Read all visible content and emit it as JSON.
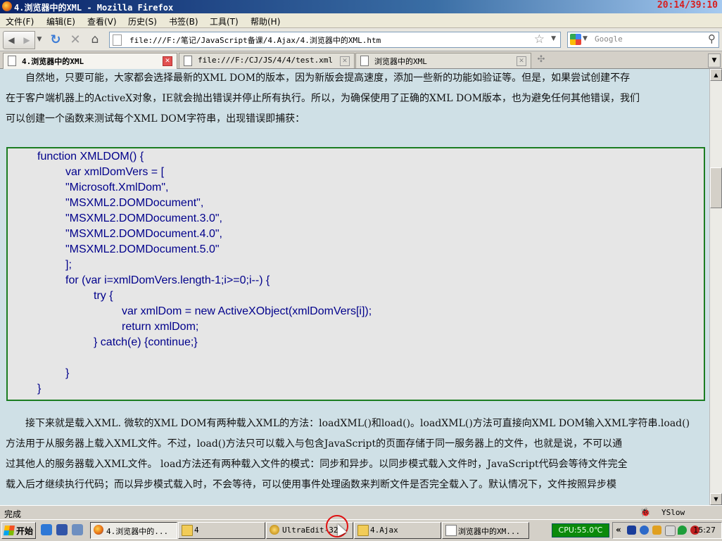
{
  "window": {
    "title": "4.浏览器中的XML - Mozilla Firefox",
    "overlay_clock": "20:14/39:10"
  },
  "menu": [
    "文件(F)",
    "编辑(E)",
    "查看(V)",
    "历史(S)",
    "书签(B)",
    "工具(T)",
    "帮助(H)"
  ],
  "nav": {
    "url": "file:///F:/笔记/JavaScript备课/4.Ajax/4.浏览器中的XML.htm",
    "search_placeholder": "Google"
  },
  "tabs": [
    {
      "label": "4.浏览器中的XML",
      "active": true
    },
    {
      "label": "file:///F:/CJ/JS/4/4/test.xml",
      "active": false
    },
    {
      "label": "浏览器中的XML",
      "active": false
    }
  ],
  "content": {
    "para1": [
      "　　自然地，只要可能，大家都会选择最新的XML DOM的版本，因为新版会提高速度，添加一些新的功能如验证等。但是，如果尝试创建不存",
      "在于客户端机器上的ActiveX对象，IE就会抛出错误并停止所有执行。所以，为确保使用了正确的XML DOM版本，也为避免任何其他错误，我们",
      "可以创建一个函数来测试每个XML DOM字符串，出现错误即捕获："
    ],
    "code": [
      {
        "indent": 0,
        "text": "function XMLDOM() {"
      },
      {
        "indent": 1,
        "text": "var xmlDomVers = ["
      },
      {
        "indent": 1,
        "text": "\"Microsoft.XmlDom\","
      },
      {
        "indent": 1,
        "text": "\"MSXML2.DOMDocument\","
      },
      {
        "indent": 1,
        "text": "\"MSXML2.DOMDocument.3.0\","
      },
      {
        "indent": 1,
        "text": "\"MSXML2.DOMDocument.4.0\","
      },
      {
        "indent": 1,
        "text": "\"MSXML2.DOMDocument.5.0\""
      },
      {
        "indent": 1,
        "text": "];"
      },
      {
        "indent": 1,
        "text": "for (var i=xmlDomVers.length-1;i>=0;i--) {"
      },
      {
        "indent": 2,
        "text": "try {"
      },
      {
        "indent": 3,
        "text": "var xmlDom = new ActiveXObject(xmlDomVers[i]);"
      },
      {
        "indent": 3,
        "text": "return xmlDom;"
      },
      {
        "indent": 2,
        "text": "} catch(e) {continue;}"
      },
      {
        "indent": 0,
        "text": ""
      },
      {
        "indent": 2,
        "text": "}"
      },
      {
        "indent": 0,
        "text": "}"
      }
    ],
    "para2": [
      "　　接下来就是载入XML. 微软的XML DOM有两种载入XML的方法：loadXML()和load()。loadXML()方法可直接向XML DOM输入XML字符串.load()",
      "方法用于从服务器上载入XML文件。不过，load()方法只可以载入与包含JavaScript的页面存储于同一服务器上的文件，也就是说，不可以通",
      "过其他人的服务器载入XML文件。 load方法还有两种载入文件的模式：同步和异步。以同步模式载入文件时，JavaScript代码会等待文件完全",
      "载入后才继续执行代码；而以异步模式载入时，不会等待，可以使用事件处理函数来判断文件是否完全载入了。默认情况下，文件按照异步模"
    ]
  },
  "status": {
    "text": "完成",
    "yslow": "YSlow"
  },
  "taskbar": {
    "start": "开始",
    "buttons": [
      {
        "label": "4.浏览器中的...",
        "icon": "firefox-icon"
      },
      {
        "label": "4",
        "icon": "folder-icon"
      },
      {
        "label": "UltraEdit-32",
        "icon": "ultraedit-icon"
      },
      {
        "label": "4.Ajax",
        "icon": "folder-icon"
      },
      {
        "label": "浏览器中的XM...",
        "icon": "page-icon"
      }
    ],
    "cpu": "CPU:55.0℃",
    "clock": "15:27"
  }
}
